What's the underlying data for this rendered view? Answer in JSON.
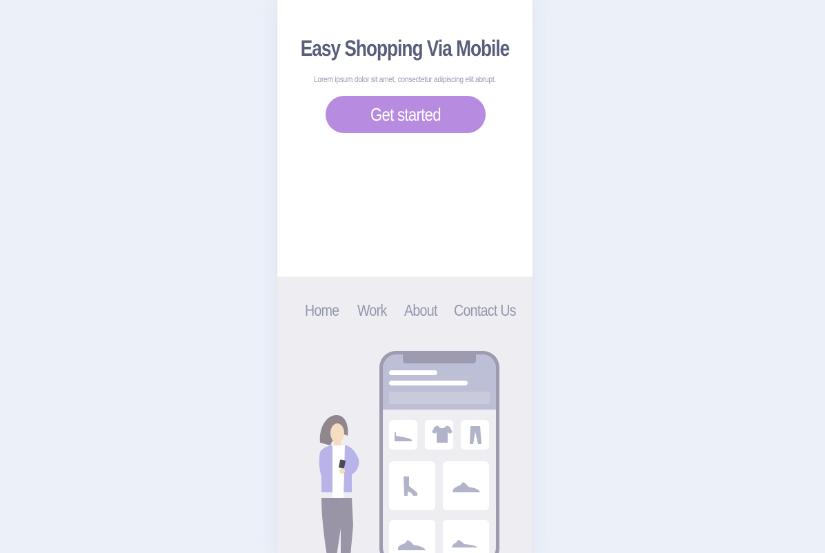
{
  "hero": {
    "title": "Easy Shopping Via Mobile",
    "subtitle": "Lorem ipsum dolor sit amet, consectetur adipiscing elit abrupt.",
    "cta_label": "Get started"
  },
  "nav": {
    "items": [
      {
        "label": "Home"
      },
      {
        "label": "Work"
      },
      {
        "label": "About"
      },
      {
        "label": "Contact Us"
      }
    ]
  },
  "illustration": {
    "icons": [
      "woman-holding-phone-icon",
      "shoe-icon",
      "tshirt-icon",
      "pants-icon",
      "high-heel-icon",
      "sneaker-icon"
    ]
  },
  "colors": {
    "page_bg": "#ecf0f8",
    "accent": "#b68be0",
    "title": "#5a5e7a",
    "nav_text": "#9296ae",
    "lower_bg": "#eeeef2"
  }
}
